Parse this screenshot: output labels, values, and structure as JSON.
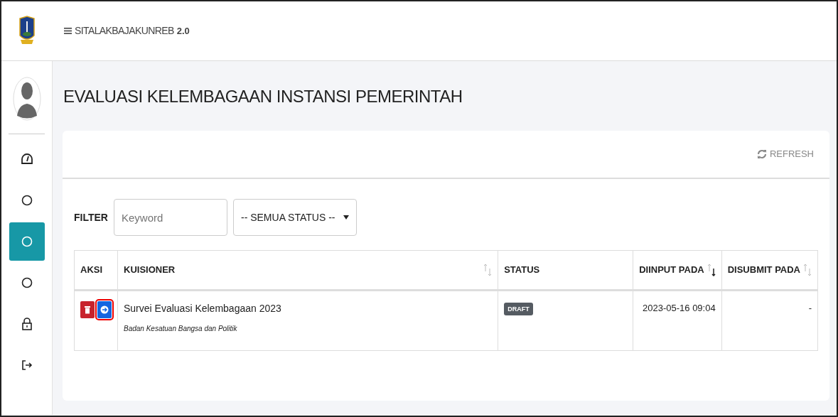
{
  "topbar": {
    "app_name": "SITALAKBAJAKUNREB",
    "version": "2.0"
  },
  "sidebar": {
    "items": [
      {
        "kind": "gauge",
        "selected": false
      },
      {
        "kind": "circle",
        "selected": false
      },
      {
        "kind": "circle",
        "selected": true
      },
      {
        "kind": "circle",
        "selected": false
      },
      {
        "kind": "lock",
        "selected": false
      },
      {
        "kind": "logout",
        "selected": false
      }
    ]
  },
  "page_title": "EVALUASI KELEMBAGAAN INSTANSI PEMERINTAH",
  "card": {
    "refresh_label": "REFRESH",
    "filter": {
      "label": "FILTER",
      "keyword_placeholder": "Keyword",
      "status_value": "-- SEMUA STATUS --"
    },
    "table": {
      "columns": [
        {
          "label": "AKSI",
          "sortable": false
        },
        {
          "label": "KUISIONER",
          "sortable": true,
          "sorted": false
        },
        {
          "label": "STATUS",
          "sortable": false
        },
        {
          "label": "DIINPUT PADA",
          "sortable": true,
          "sorted": true
        },
        {
          "label": "DISUBMIT PADA",
          "sortable": true,
          "sorted": false
        }
      ],
      "rows": [
        {
          "actions": [
            {
              "kind": "delete",
              "highlighted": false
            },
            {
              "kind": "open",
              "highlighted": true
            }
          ],
          "title": "Survei Evaluasi Kelembagaan 2023",
          "subtitle": "Badan Kesatuan Bangsa dan Politik",
          "status": "DRAFT",
          "input_at": "2023-05-16 09:04",
          "submit_at": "-"
        }
      ]
    }
  }
}
